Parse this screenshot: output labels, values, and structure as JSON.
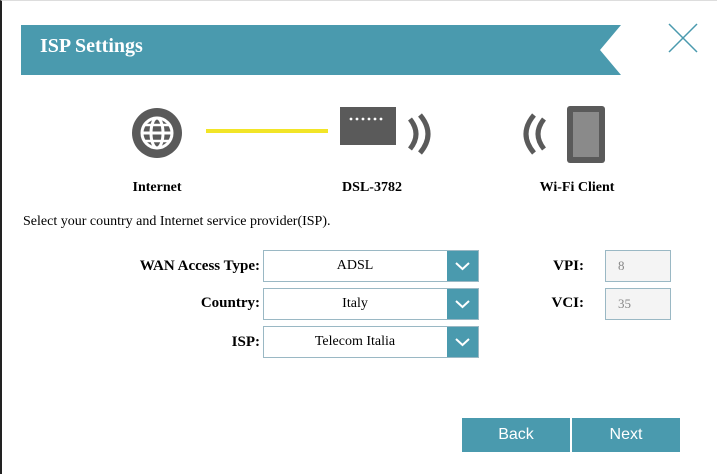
{
  "dialog": {
    "title": "ISP Settings",
    "close_icon": "close-icon"
  },
  "diagram": {
    "internet_label": "Internet",
    "router_label": "DSL-3782",
    "client_label": "Wi-Fi Client",
    "link_color": "#f2e527"
  },
  "instruction": "Select your country and Internet service provider(ISP).",
  "form": {
    "wan_access_type": {
      "label": "WAN Access Type:",
      "value": "ADSL"
    },
    "country": {
      "label": "Country:",
      "value": "Italy"
    },
    "isp": {
      "label": "ISP:",
      "value": "Telecom Italia"
    },
    "vpi": {
      "label": "VPI:",
      "value": "8"
    },
    "vci": {
      "label": "VCI:",
      "value": "35"
    }
  },
  "buttons": {
    "back": "Back",
    "next": "Next"
  },
  "colors": {
    "accent": "#4a9aae",
    "icon_gray": "#5a5a5a"
  }
}
